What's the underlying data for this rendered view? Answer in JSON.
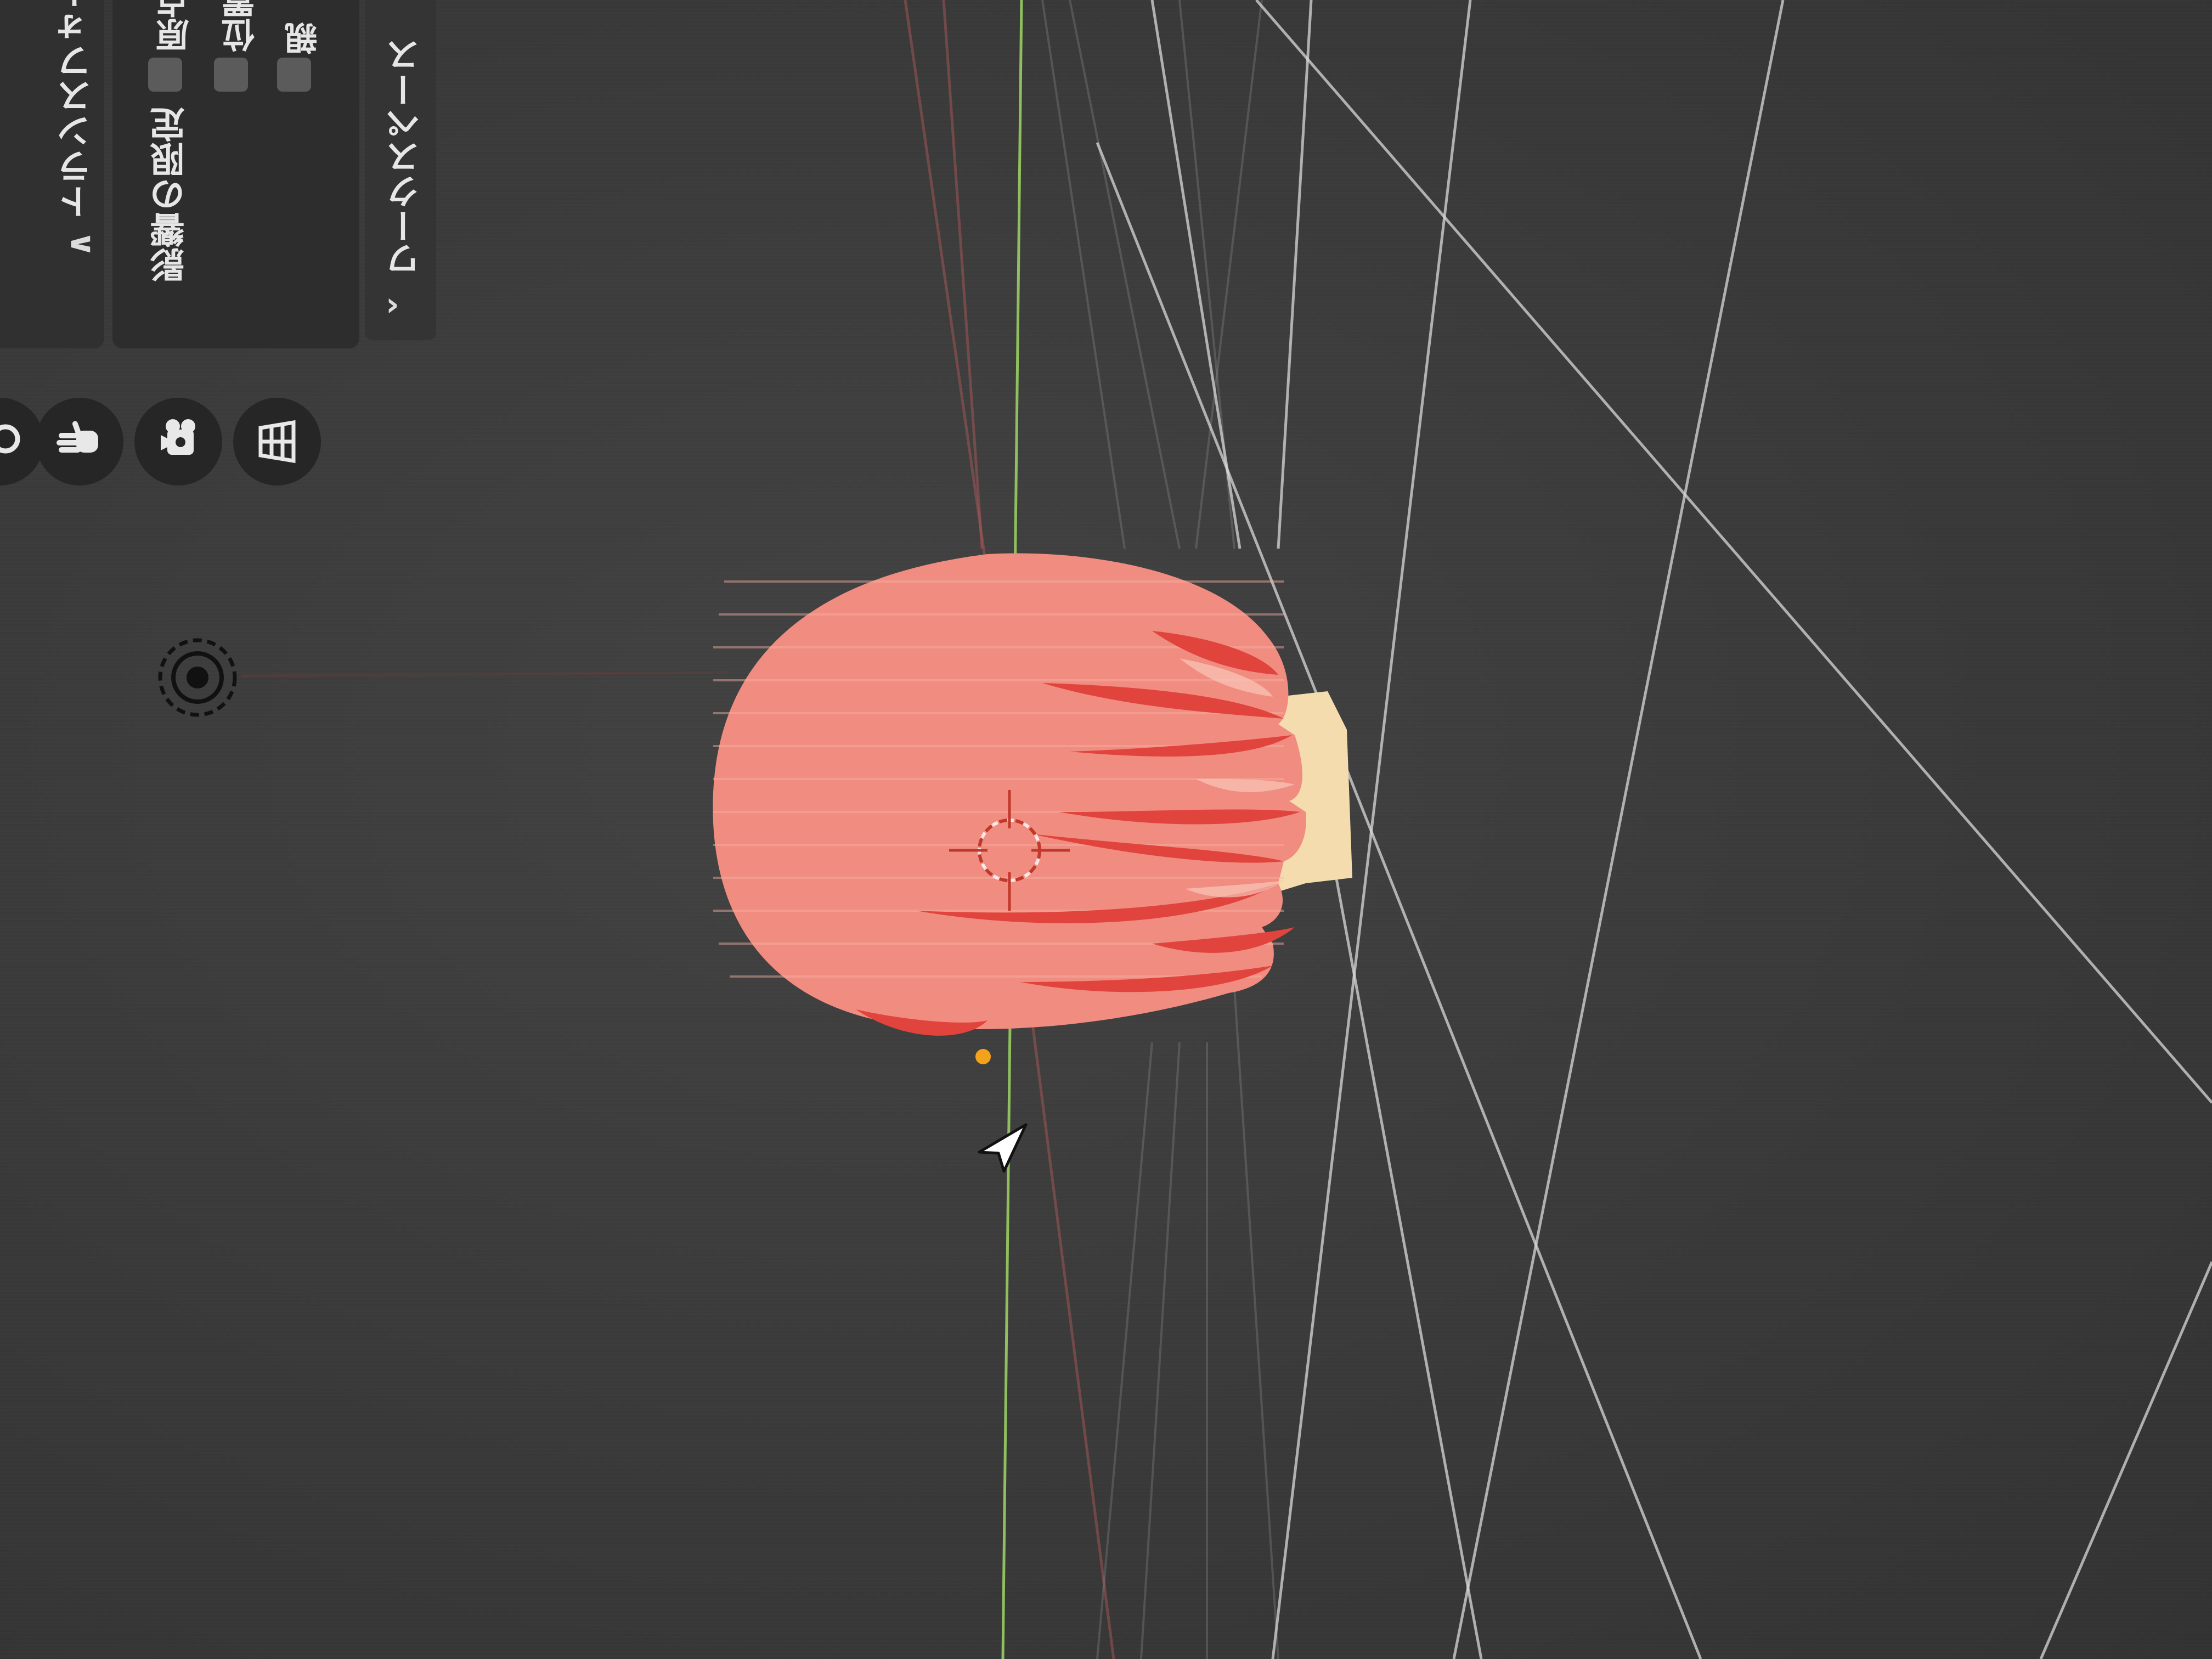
{
  "panel": {
    "transform_header": "トランスフォーム",
    "affect_only_label": "影響の限定",
    "options": [
      {
        "label": "原点",
        "checked": false
      },
      {
        "label": "位置",
        "checked": false
      },
      {
        "label": "親",
        "checked": false
      }
    ],
    "workspace_header": "ワークスペース"
  },
  "nav_gizmo": {
    "buttons": [
      {
        "name": "zoom",
        "icon": "magnifier-icon"
      },
      {
        "name": "pan",
        "icon": "hand-icon"
      },
      {
        "name": "camera",
        "icon": "camera-icon"
      },
      {
        "name": "perspective",
        "icon": "grid-icon"
      }
    ]
  },
  "viewport": {
    "object": "hair-mesh",
    "object_color": "#f08c80",
    "highlight_color": "#e0443c",
    "face_color": "#f4dcae",
    "y_axis_color": "#8fbf5f",
    "x_axis_color": "#c86464",
    "selection_origin_color": "#f4a21c",
    "light_icon": "light-icon",
    "cursor_icon": "3d-cursor-icon"
  }
}
